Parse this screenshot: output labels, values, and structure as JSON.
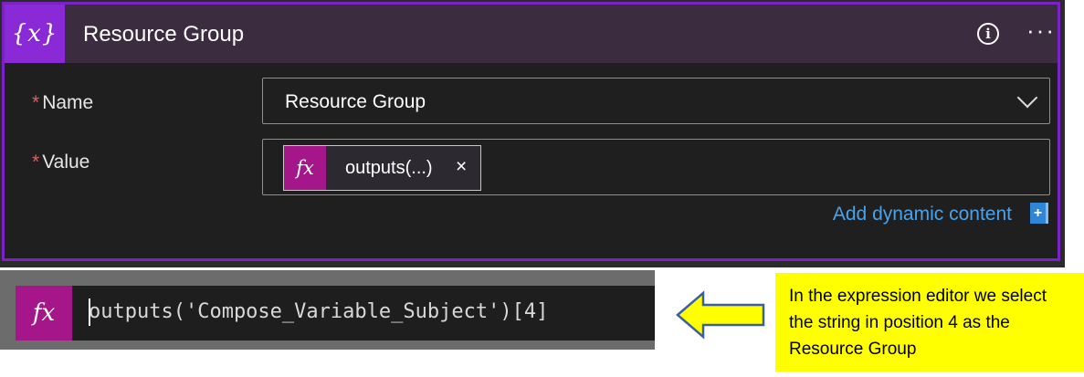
{
  "card": {
    "icon_text": "{x}",
    "title": "Resource Group",
    "info_icon": "info-icon",
    "more_icon": "more-icon"
  },
  "fields": {
    "required_mark": "*",
    "name_label": "Name",
    "name_value": "Resource Group",
    "value_label": "Value",
    "token_fx": "fx",
    "token_text": "outputs(...)",
    "token_remove": "×"
  },
  "dynamic": {
    "add_label": "Add dynamic content",
    "add_icon": "+"
  },
  "expression": {
    "fx": "fx",
    "text": "outputs('Compose_Variable_Subject')[4]"
  },
  "callout": {
    "text": "In the expression editor we select the string in position 4 as the Resource Group"
  },
  "colors": {
    "accent_purple": "#7a21c8",
    "fx_magenta": "#a4168a",
    "link_blue": "#4aa3ea",
    "note_yellow": "#ffff00"
  }
}
